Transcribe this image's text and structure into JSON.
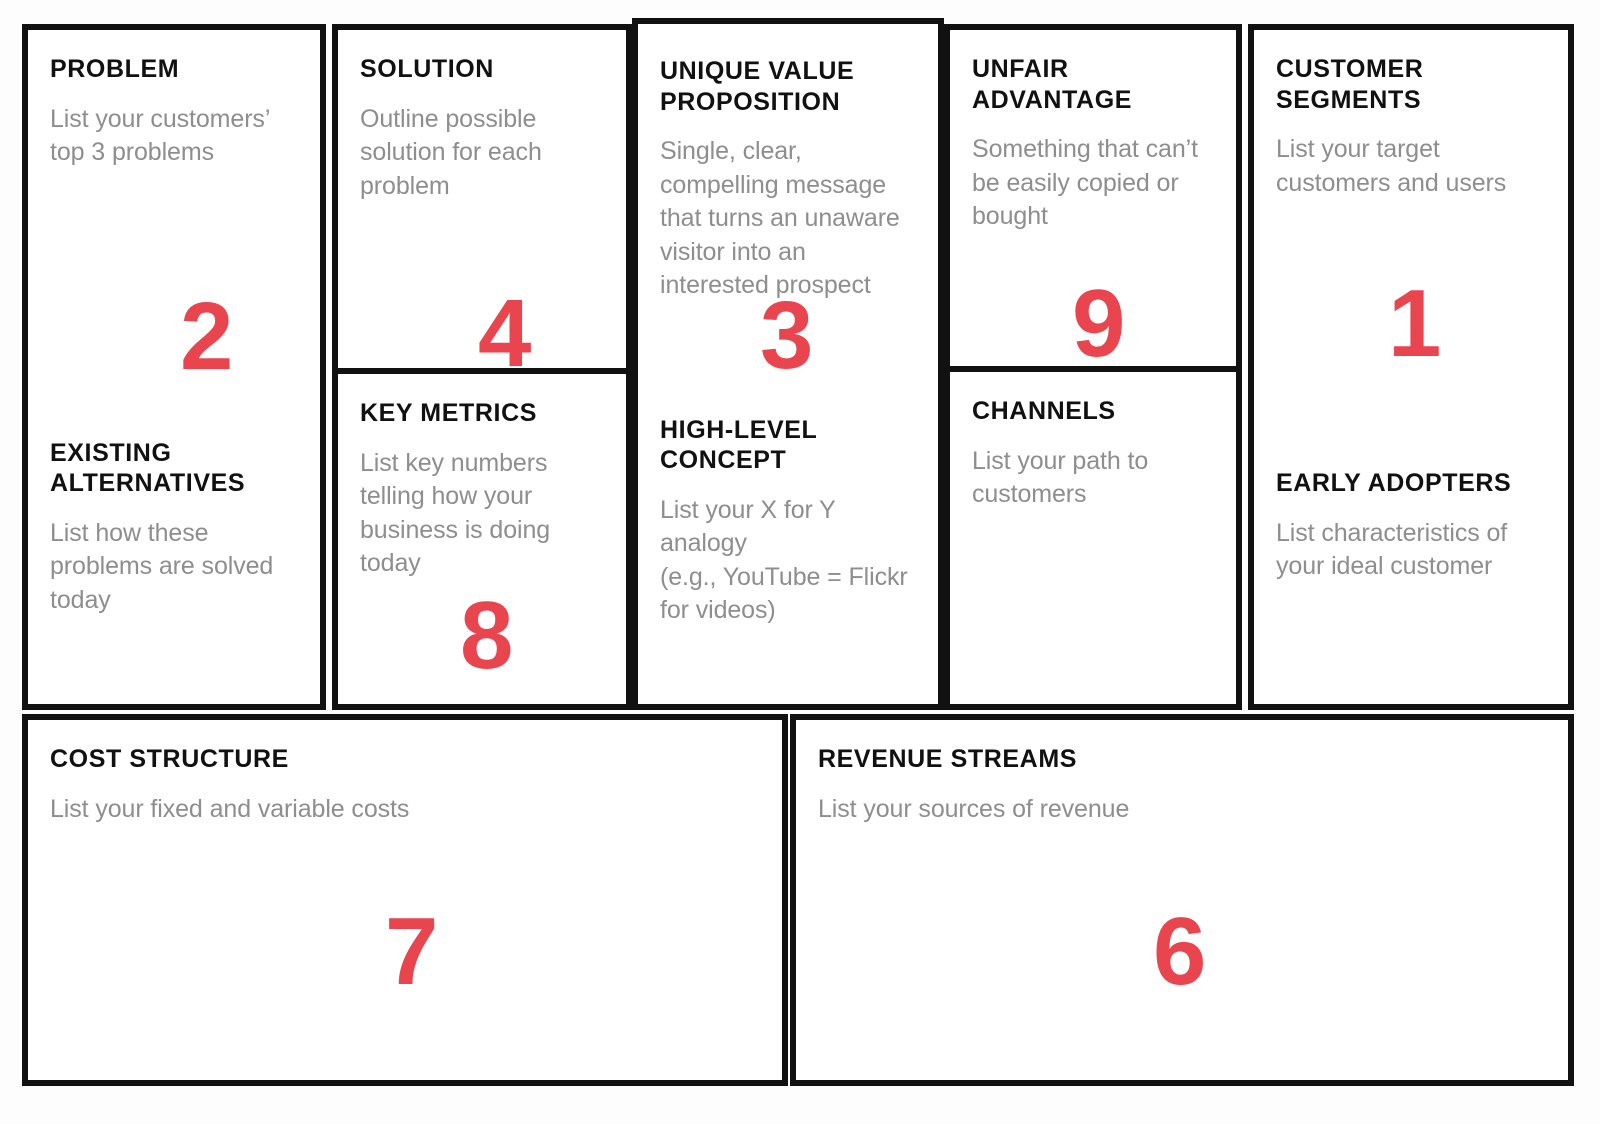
{
  "meta": {
    "canvas_title": "Lean Canvas",
    "accent_color": "#e8454f",
    "border_color": "#111111",
    "title_color": "#111111",
    "body_color": "#8e8e8e",
    "background_color": "#ffffff"
  },
  "blocks": {
    "problem": {
      "title": "PROBLEM",
      "description": "List your customers’ top 3 problems",
      "number": "2"
    },
    "existing_alternatives": {
      "title": "EXISTING ALTERNATIVES",
      "description": "List how these problems are solved today",
      "number": ""
    },
    "solution": {
      "title": "SOLUTION",
      "description": "Outline possible solution for each problem",
      "number": "4"
    },
    "key_metrics": {
      "title": "KEY METRICS",
      "description": "List key numbers telling how your business is doing today",
      "number": "8"
    },
    "unique_value_proposition": {
      "title": "UNIQUE VALUE PROPOSITION",
      "description": "Single, clear, compelling message that turns an unaware visitor into an interested prospect",
      "number": "3"
    },
    "high_level_concept": {
      "title": "HIGH-LEVEL CONCEPT",
      "description": "List your X for Y analogy\n(e.g., YouTube = Flickr for videos)",
      "number": ""
    },
    "unfair_advantage": {
      "title": "UNFAIR ADVANTAGE",
      "description": "Something that can’t be easily copied or bought",
      "number": "9"
    },
    "channels": {
      "title": "CHANNELS",
      "description": "List your path to customers",
      "number": ""
    },
    "customer_segments": {
      "title": "CUSTOMER SEGMENTS",
      "description": "List your target customers and users",
      "number": "1"
    },
    "early_adopters": {
      "title": "EARLY ADOPTERS",
      "description": "List characteristics of your ideal customer",
      "number": ""
    },
    "cost_structure": {
      "title": "COST STRUCTURE",
      "description": "List your fixed and variable costs",
      "number": "7"
    },
    "revenue_streams": {
      "title": "REVENUE STREAMS",
      "description": "List your sources of revenue",
      "number": "6"
    }
  }
}
